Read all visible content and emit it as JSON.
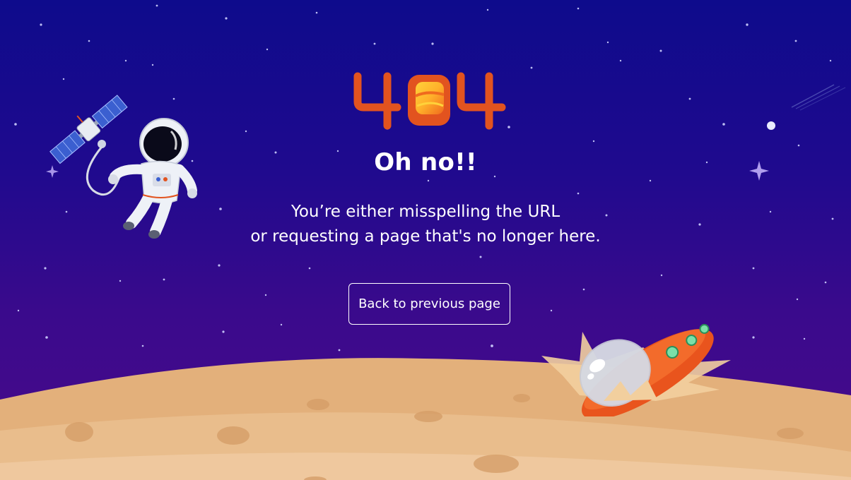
{
  "error": {
    "code_image_label": "404",
    "heading": "Oh no!!",
    "message_line1": "You’re either misspelling the URL",
    "message_line2": "or requesting a page that's no longer here."
  },
  "actions": {
    "back_label": "Back to previous page"
  },
  "colors": {
    "sky_top": "#0e0b8c",
    "sky_bottom": "#4a0a8a",
    "sand": "#e6b583",
    "sand_light": "#efc79c",
    "accent_orange": "#e2531f",
    "text": "#ffffff"
  },
  "icons": [
    "astronaut-icon",
    "satellite-icon",
    "ufo-icon",
    "comet-icon",
    "star-icon"
  ]
}
